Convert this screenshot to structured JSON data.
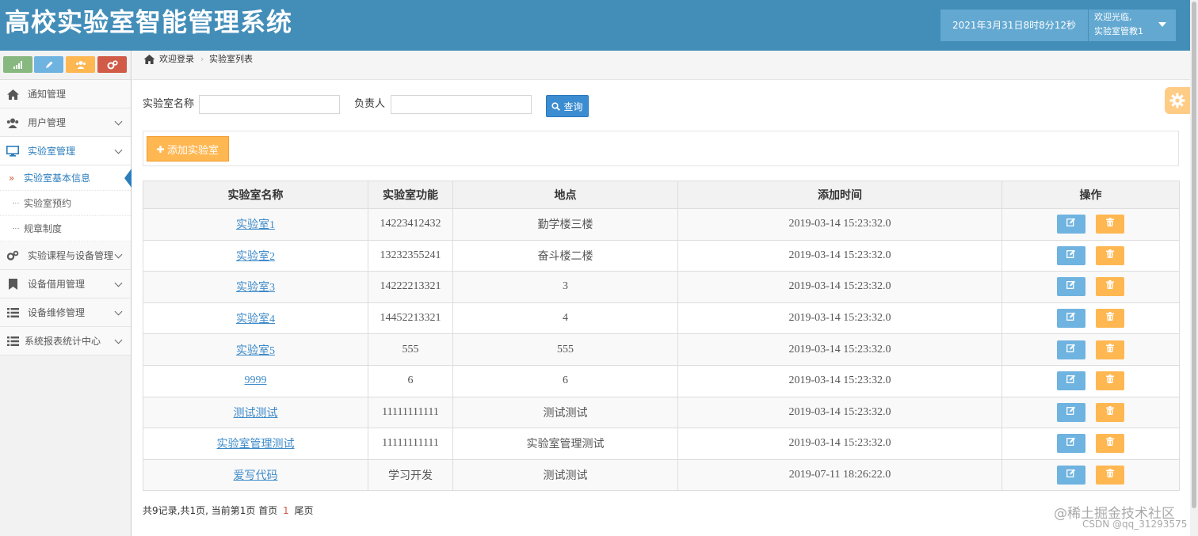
{
  "header": {
    "title": "高校实验室智能管理系统",
    "datetime": "2021年3月31日8时8分12秒",
    "welcome": "欢迎光临,",
    "username": "实验室管教1"
  },
  "shortcuts": [
    {
      "icon": "signal-icon",
      "color": "#87b87f"
    },
    {
      "icon": "pencil-icon",
      "color": "#6fb3e0"
    },
    {
      "icon": "users-icon",
      "color": "#ffb752"
    },
    {
      "icon": "cogs-icon",
      "color": "#d15b47"
    }
  ],
  "sidebar": {
    "items": [
      {
        "label": "通知管理",
        "icon": "home-icon"
      },
      {
        "label": "用户管理",
        "icon": "users-icon"
      },
      {
        "label": "实验室管理",
        "icon": "desktop-icon"
      },
      {
        "label": "实验课程与设备管理",
        "icon": "cogs-icon"
      },
      {
        "label": "设备借用管理",
        "icon": "bookmark-icon"
      },
      {
        "label": "设备维修管理",
        "icon": "list-icon"
      },
      {
        "label": "系统报表统计中心",
        "icon": "list-icon"
      }
    ],
    "subitems": [
      {
        "label": "实验室基本信息",
        "active": true
      },
      {
        "label": "实验室预约"
      },
      {
        "label": "规章制度"
      }
    ],
    "active_arrow": "»"
  },
  "breadcrumb": {
    "home": "欢迎登录",
    "separator": "›",
    "current": "实验室列表"
  },
  "search": {
    "name_label": "实验室名称",
    "name_value": "",
    "owner_label": "负责人",
    "owner_value": "",
    "button_label": "查询"
  },
  "toolbar": {
    "add_label": "添加实验室"
  },
  "table": {
    "headers": [
      "实验室名称",
      "实验室功能",
      "地点",
      "添加时间",
      "操作"
    ],
    "rows": [
      [
        "实验室1",
        "14223412432",
        "勤学楼三楼",
        "2019-03-14 15:23:32.0"
      ],
      [
        "实验室2",
        "13232355241",
        "奋斗楼二楼",
        "2019-03-14 15:23:32.0"
      ],
      [
        "实验室3",
        "14222213321",
        "3",
        "2019-03-14 15:23:32.0"
      ],
      [
        "实验室4",
        "14452213321",
        "4",
        "2019-03-14 15:23:32.0"
      ],
      [
        "实验室5",
        "555",
        "555",
        "2019-03-14 15:23:32.0"
      ],
      [
        "9999",
        "6",
        "6",
        "2019-03-14 15:23:32.0"
      ],
      [
        "测试测试",
        "11111111111",
        "测试测试",
        "2019-03-14 15:23:32.0"
      ],
      [
        "实验室管理测试",
        "11111111111",
        "实验室管理测试",
        "2019-03-14 15:23:32.0"
      ],
      [
        "爱写代码",
        "学习开发",
        "测试测试",
        "2019-07-11 18:26:22.0"
      ]
    ]
  },
  "pagination": {
    "summary": "共9记录,共1页, 当前第1页",
    "first": "首页",
    "current": "1",
    "last": "尾页"
  },
  "watermark": {
    "line1": "@稀土掘金技术社区",
    "line2": "CSDN @qq_31293575"
  },
  "colors": {
    "header_bg": "#438eb9",
    "accent_blue": "#2b7dbc",
    "edit_btn": "#6fb3e0",
    "delete_btn": "#ffb752"
  }
}
